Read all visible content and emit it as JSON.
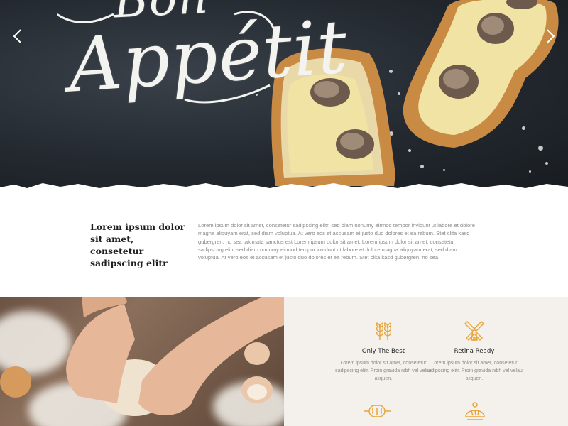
{
  "hero": {
    "script_line_1": "Bon",
    "script_line_2": "Appétit",
    "prev_icon": "chevron-left-icon",
    "next_icon": "chevron-right-icon"
  },
  "intro": {
    "heading": "Lorem ipsum dolor sit amet, consetetur sadipscing elitr",
    "body": "Lorem ipsum dolor sit amet, consetetur sadipscing elitr, sed diam nonumy eirmod tempor invidunt ut labore et dolore magna aliquyam erat, sed diam voluptua. At vero eos et accusam et justo duo dolores et ea rebum. Stet clita kasd gubergren, no sea takimata sanctus est Lorem ipsum dolor sit amet. Lorem ipsum dolor sit amet, consetetur sadipscing elitr, sed diam nonumy eirmod tempor invidunt ut labore et dolore magna aliquyam erat, sed diam voluptua. At vero eos et accusam et justo duo dolores et ea rebum. Stet clita kasd gubergren, no sea."
  },
  "features": {
    "items": [
      {
        "icon": "wheat-icon",
        "title": "Only The Best",
        "text": "Lorem ipsum dolor sit amet, consetetur sadipscing elitr. Proin gravida nibh vel velau aliquen."
      },
      {
        "icon": "windmill-icon",
        "title": "Retina Ready",
        "text": "Lorem ipsum dolor sit amet, consetetur sadipscing elitr. Proin gravida nibh vel velau aliquen."
      }
    ],
    "lower_icons": [
      "rolling-pin-icon",
      "bread-icon"
    ]
  },
  "colors": {
    "accent": "#e8a43a",
    "hero_bg": "#23292f",
    "panel_bg": "#f4f1ec",
    "heading": "#1f1f1f",
    "body_text": "#8a8a8a"
  }
}
